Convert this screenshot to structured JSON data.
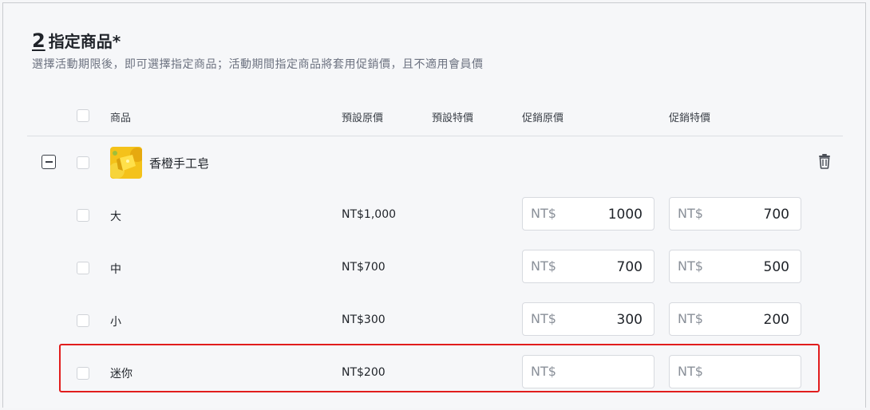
{
  "section": {
    "number": "2",
    "title": "指定商品*",
    "description": "選擇活動期限後，即可選擇指定商品；活動期間指定商品將套用促銷價，且不適用會員價"
  },
  "table": {
    "headers": {
      "product": "商品",
      "default_price": "預設原價",
      "default_special": "預設特價",
      "promo_price": "促銷原價",
      "promo_special": "促銷特價"
    },
    "product": {
      "name": "香橙手工皂",
      "thumbnail_icon": "soap-thumbnail-icon"
    },
    "currency_prefix": "NT$",
    "variants": [
      {
        "name": "大",
        "default_price": "NT$1,000",
        "promo_price": "1000",
        "promo_special": "700"
      },
      {
        "name": "中",
        "default_price": "NT$700",
        "promo_price": "700",
        "promo_special": "500"
      },
      {
        "name": "小",
        "default_price": "NT$300",
        "promo_price": "300",
        "promo_special": "200"
      },
      {
        "name": "迷你",
        "default_price": "NT$200",
        "promo_price": "",
        "promo_special": ""
      }
    ]
  },
  "colors": {
    "highlight": "#e11d1d",
    "text": "#1f2329",
    "muted": "#6c7280"
  }
}
